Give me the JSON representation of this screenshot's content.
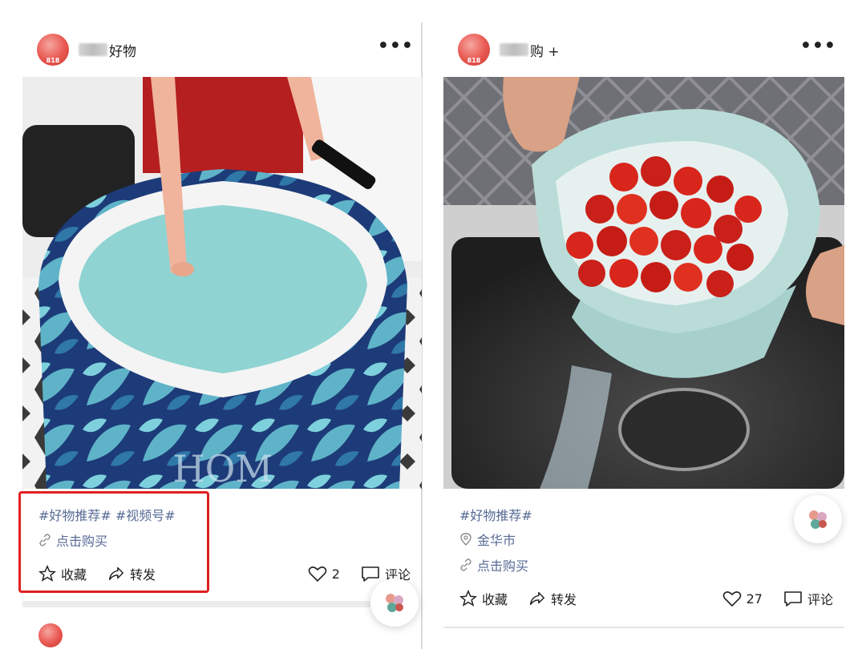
{
  "posts": [
    {
      "avatar_badge": "818",
      "name_suffix": "好物",
      "more": "•••",
      "hashtags": "#好物推荐# #视频号#",
      "buy_link": "点击购买",
      "actions": {
        "favorite": "收藏",
        "share": "转发",
        "likes": "2",
        "comment": "评论"
      }
    },
    {
      "avatar_badge": "818",
      "name_suffix": "购 +",
      "more": "•••",
      "hashtags": "#好物推荐#",
      "location": "金华市",
      "buy_link": "点击购买",
      "actions": {
        "favorite": "收藏",
        "share": "转发",
        "likes": "27",
        "comment": "评论"
      }
    }
  ],
  "colors": {
    "link": "#576b95",
    "highlight_box": "#e02020",
    "avatar": "#e8564f"
  },
  "icons": [
    "more-icon",
    "link-icon",
    "location-icon",
    "star-icon",
    "share-icon",
    "heart-icon",
    "comment-icon",
    "float-app-icon"
  ]
}
